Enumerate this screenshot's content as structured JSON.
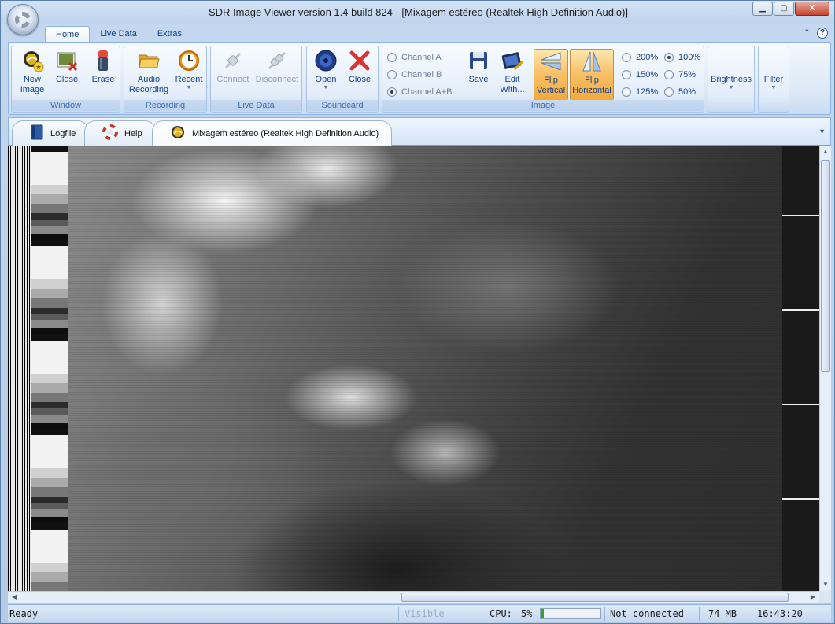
{
  "window": {
    "title": "SDR Image Viewer version 1.4 build 824 - [Mixagem estéreo (Realtek High Definition Audio)]",
    "controls": {
      "minimize": "▁",
      "maximize": "▢",
      "close": "X"
    }
  },
  "ribbon_tabs": [
    "Home",
    "Live Data",
    "Extras"
  ],
  "ribbon_corner": {
    "collapse": "⌃",
    "help": "?"
  },
  "groups": {
    "window": {
      "label": "Window",
      "new_image": "New Image",
      "close": "Close",
      "erase": "Erase"
    },
    "recording": {
      "label": "Recording",
      "audio_recording": "Audio Recording",
      "recent": "Recent"
    },
    "live_data": {
      "label": "Live Data",
      "connect": "Connect",
      "disconnect": "Disconnect"
    },
    "soundcard": {
      "label": "Soundcard",
      "open": "Open",
      "close": "Close"
    },
    "image": {
      "label": "Image",
      "channels": [
        {
          "label": "Channel A",
          "checked": false
        },
        {
          "label": "Channel B",
          "checked": false
        },
        {
          "label": "Channel A+B",
          "checked": true
        }
      ],
      "save": "Save",
      "edit_with": "Edit With...",
      "flip_vertical": "Flip Vertical",
      "flip_horizontal": "Flip Horizontal",
      "zoom": [
        {
          "label": "200%",
          "checked": false
        },
        {
          "label": "100%",
          "checked": true
        },
        {
          "label": "150%",
          "checked": false
        },
        {
          "label": "75%",
          "checked": false
        },
        {
          "label": "125%",
          "checked": false
        },
        {
          "label": "50%",
          "checked": false
        }
      ]
    },
    "brightness": "Brightness",
    "filter": "Filter"
  },
  "doc_tabs": [
    {
      "label": "Logfile",
      "icon": "book-icon"
    },
    {
      "label": "Help",
      "icon": "lifebuoy-icon"
    },
    {
      "label": "Mixagem estéreo (Realtek High Definition Audio)",
      "icon": "satellite-image-icon"
    }
  ],
  "status": {
    "state": "Ready",
    "channel": "Visible",
    "cpu_label": "CPU:",
    "cpu_value": "5%",
    "cpu_percent": 5,
    "connection": "Not connected",
    "memory": "74 MB",
    "time": "16:43:20"
  },
  "colors": {
    "accent": "#15428b",
    "pressed": "#f9c26a",
    "cpu_fill": "#2fa52f"
  }
}
